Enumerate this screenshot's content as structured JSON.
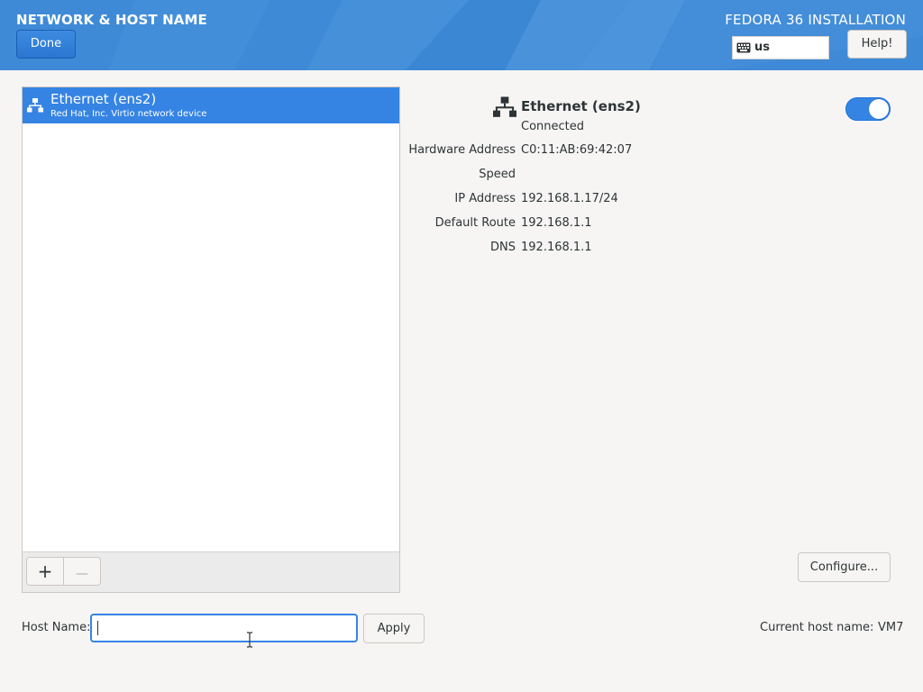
{
  "header": {
    "page_title": "NETWORK & HOST NAME",
    "product_title": "FEDORA 36 INSTALLATION",
    "done_label": "Done",
    "help_label": "Help!",
    "keyboard_layout": "us",
    "banner_color": "#3f8ad6"
  },
  "devices": [
    {
      "name": "Ethernet (ens2)",
      "description": "Red Hat, Inc. Virtio network device",
      "icon": "network-wired-icon",
      "selected": true
    }
  ],
  "toolbar": {
    "add_glyph": "+",
    "remove_glyph": "—"
  },
  "details": {
    "title": "Ethernet (ens2)",
    "status": "Connected",
    "enabled": true,
    "rows": [
      {
        "label": "Hardware Address",
        "value": "C0:11:AB:69:42:07"
      },
      {
        "label": "Speed",
        "value": ""
      },
      {
        "label": "IP Address",
        "value": "192.168.1.17/24"
      },
      {
        "label": "Default Route",
        "value": "192.168.1.1"
      },
      {
        "label": "DNS",
        "value": "192.168.1.1"
      }
    ],
    "configure_label": "Configure..."
  },
  "hostname": {
    "label": "Host Name:",
    "value": "",
    "apply_label": "Apply",
    "current_label": "Current host name:",
    "current_value": "VM7"
  },
  "colors": {
    "accent": "#3584e4",
    "background": "#f6f5f4"
  }
}
